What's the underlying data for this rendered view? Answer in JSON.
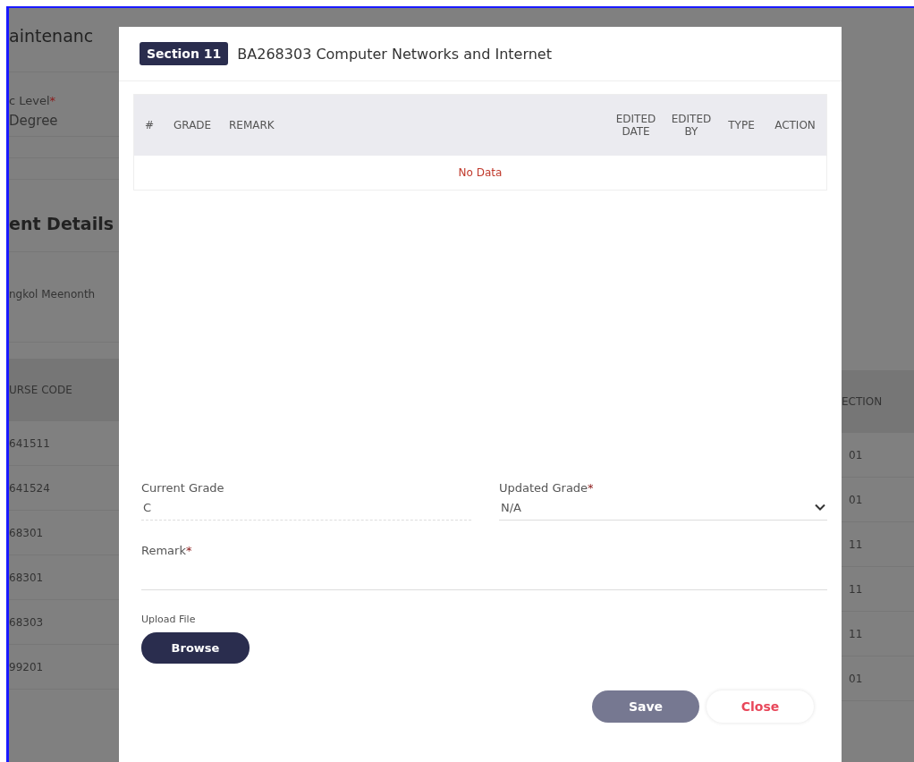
{
  "background_page": {
    "title": "aintenanc",
    "level_label": {
      "text": "c Level",
      "required_mark": "*"
    },
    "level_value": "Degree",
    "section_heading": "ent Details",
    "student_name": "ngkol Meenonth",
    "table": {
      "columns": [
        "URSE CODE",
        "ECTION"
      ],
      "rows": [
        [
          "641511",
          "01"
        ],
        [
          "641524",
          "01"
        ],
        [
          "68301",
          "11"
        ],
        [
          "68301",
          "11"
        ],
        [
          "68303",
          "11"
        ],
        [
          "99201",
          "01"
        ]
      ]
    }
  },
  "dialog": {
    "badge": "Section 11",
    "title": "BA268303 Computer Networks and Internet",
    "history_table": {
      "columns": [
        "#",
        "GRADE",
        "REMARK",
        "EDITED DATE",
        "EDITED BY",
        "TYPE",
        "ACTION"
      ],
      "empty_text": "No Data"
    },
    "current_grade": {
      "label": "Current Grade",
      "value": "C"
    },
    "updated_grade": {
      "label": "Updated Grade",
      "required_mark": "*",
      "value": "N/A"
    },
    "remark": {
      "label": "Remark",
      "required_mark": "*"
    },
    "upload_label": "Upload File",
    "browse_button": "Browse",
    "buttons": [
      {
        "label": "Save",
        "kind": "primary"
      },
      {
        "label": "Close",
        "kind": "secondary"
      }
    ]
  }
}
